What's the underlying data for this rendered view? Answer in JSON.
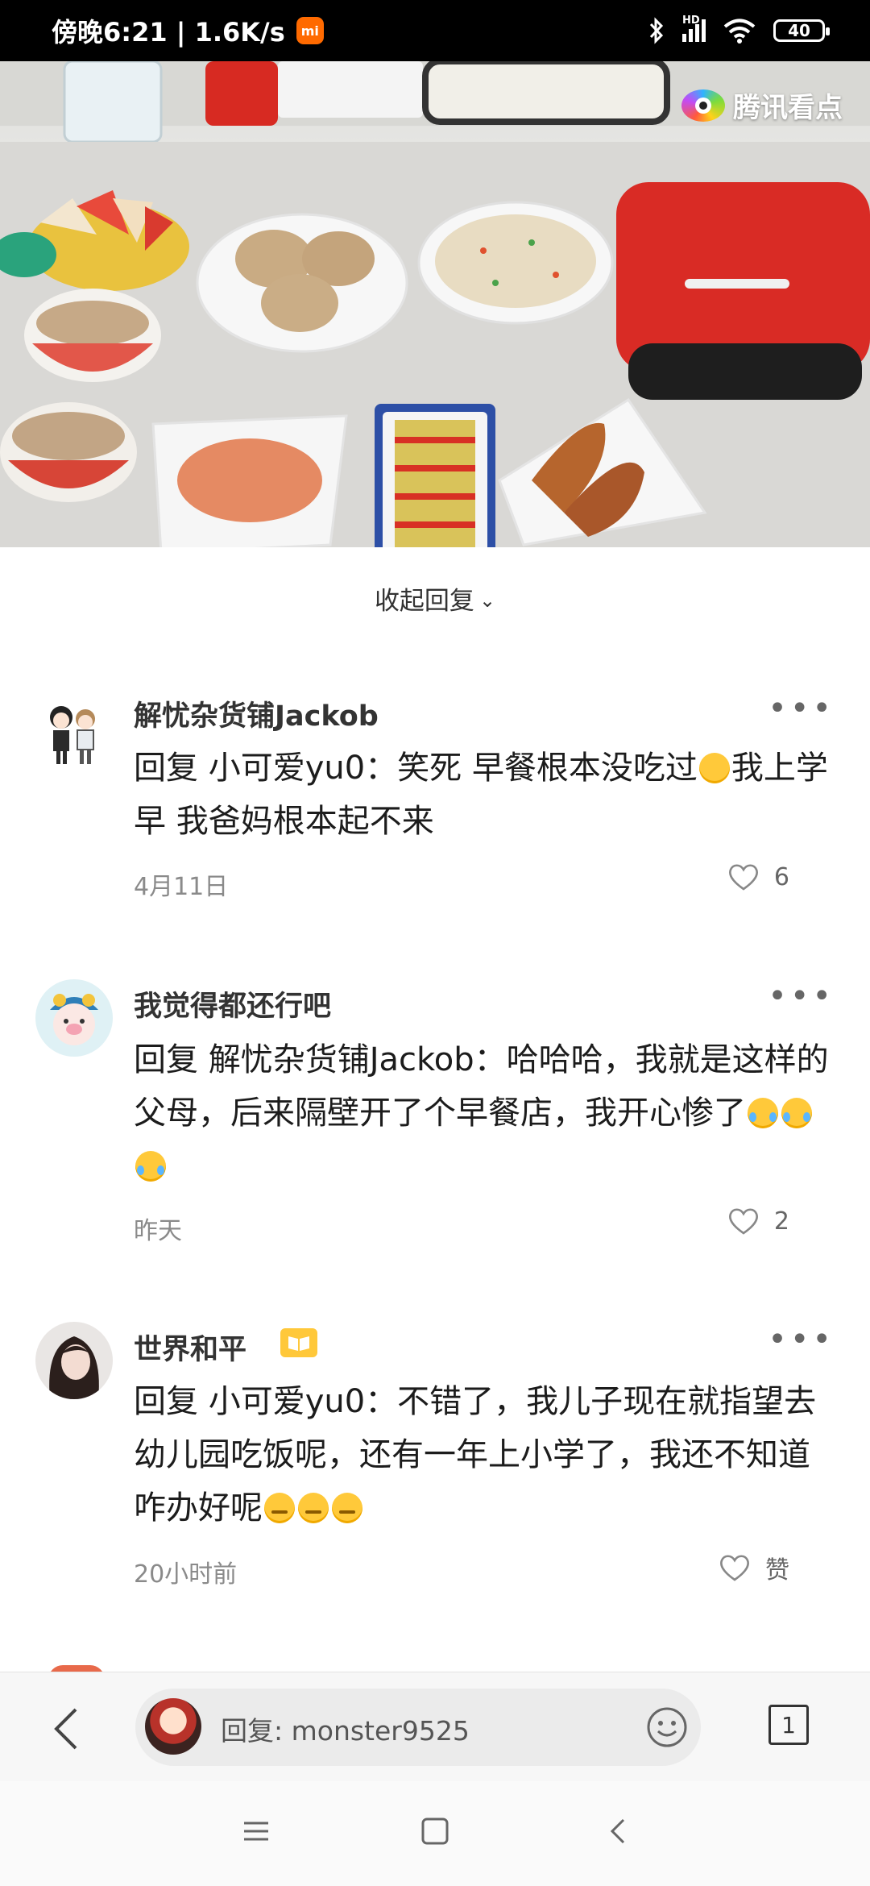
{
  "status_bar": {
    "time_speed": "傍晚6:21 | 1.6K/s",
    "hd_label": "HD",
    "battery": "40"
  },
  "video": {
    "watermark": "腾讯看点"
  },
  "collapse_replies": "收起回复",
  "comments": [
    {
      "name": "解忧杂货铺Jackob",
      "text": "回复 小可爱yu0：笑死 早餐根本没吃过",
      "text_tail": "我上学早 我爸妈根本起不来",
      "date": "4月11日",
      "likes": "6"
    },
    {
      "name": "我觉得都还行吧",
      "text": "回复 解忧杂货铺Jackob：哈哈哈，我就是这样的父母，后来隔壁开了个早餐店，我开心惨了",
      "date": "昨天",
      "likes": "2"
    },
    {
      "name": "世界和平",
      "text": "回复 小可爱yu0：不错了，我儿子现在就指望去幼儿园吃饭呢，还有一年上小学了，我还不知道咋办好呢",
      "date": "20小时前",
      "likes": "赞"
    }
  ],
  "reply_bar": {
    "placeholder": "回复: monster9525",
    "page_count": "1"
  },
  "colors": {
    "accent_red": "#d9312b",
    "status_bg": "#000000",
    "text_gray": "#8a8a8a"
  }
}
